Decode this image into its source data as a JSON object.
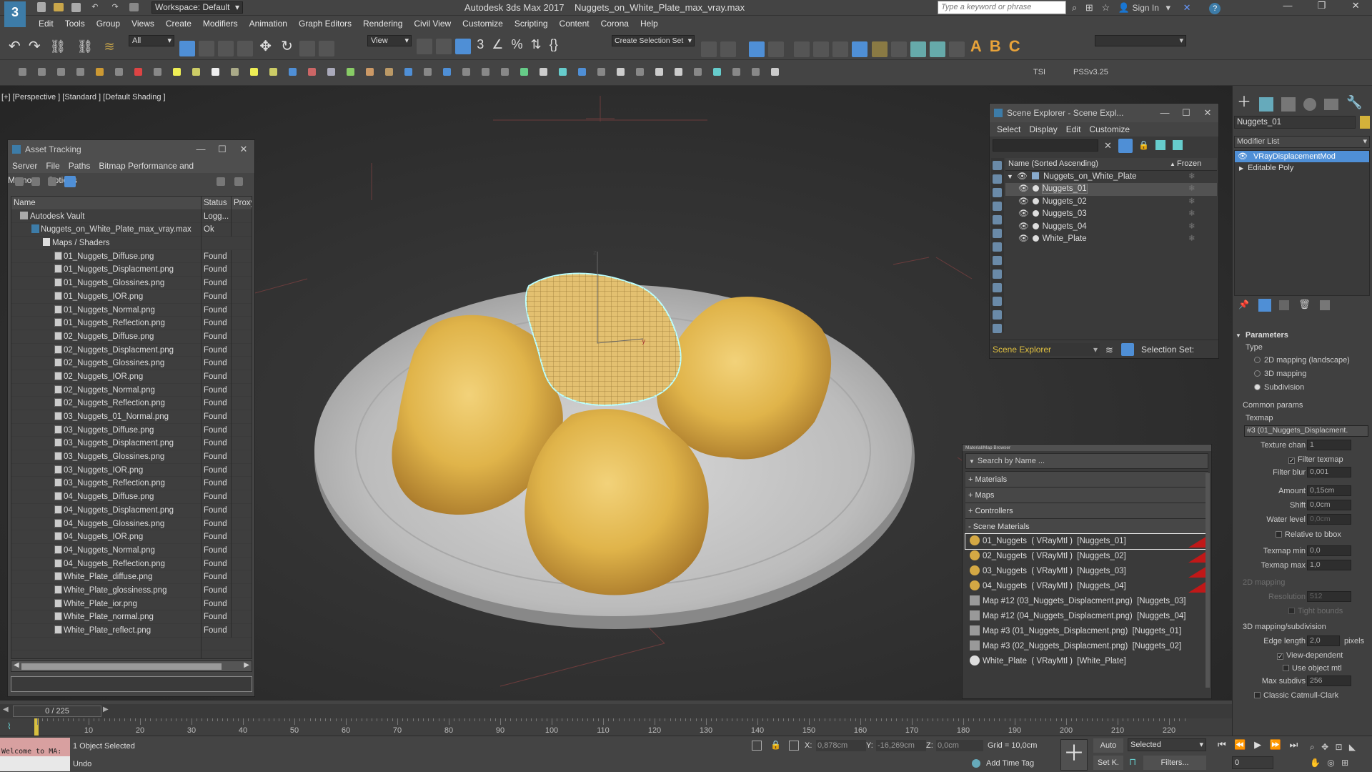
{
  "app": {
    "title": "Autodesk 3ds Max 2017",
    "file": "Nuggets_on_White_Plate_max_vray.max",
    "workspace": "Workspace: Default",
    "search_placeholder": "Type a keyword or phrase",
    "sign_in": "Sign In"
  },
  "menu": [
    "Edit",
    "Tools",
    "Group",
    "Views",
    "Create",
    "Modifiers",
    "Animation",
    "Graph Editors",
    "Rendering",
    "Civil View",
    "Customize",
    "Scripting",
    "Content",
    "Corona",
    "Help"
  ],
  "toolbar": {
    "filter": "All",
    "view": "View",
    "selection_set": "Create Selection Set",
    "tsi": "TSI",
    "pss": "PSSv3.25"
  },
  "viewport": {
    "label": "[+] [Perspective ] [Standard ] [Default Shading ]"
  },
  "asset_tracking": {
    "title": "Asset Tracking",
    "menu": [
      "Server",
      "File",
      "Paths",
      "Bitmap Performance and Memory",
      "Options"
    ],
    "columns": [
      "Name",
      "Status",
      "Proxy"
    ],
    "vault": {
      "name": "Autodesk Vault",
      "status": "Logg..."
    },
    "file": {
      "name": "Nuggets_on_White_Plate_max_vray.max",
      "status": "Ok"
    },
    "group": "Maps / Shaders",
    "maps": [
      "01_Nuggets_Diffuse.png",
      "01_Nuggets_Displacment.png",
      "01_Nuggets_Glossines.png",
      "01_Nuggets_IOR.png",
      "01_Nuggets_Normal.png",
      "01_Nuggets_Reflection.png",
      "02_Nuggets_Diffuse.png",
      "02_Nuggets_Displacment.png",
      "02_Nuggets_Glossines.png",
      "02_Nuggets_IOR.png",
      "02_Nuggets_Normal.png",
      "02_Nuggets_Reflection.png",
      "03_Nuggets_01_Normal.png",
      "03_Nuggets_Diffuse.png",
      "03_Nuggets_Displacment.png",
      "03_Nuggets_Glossines.png",
      "03_Nuggets_IOR.png",
      "03_Nuggets_Reflection.png",
      "04_Nuggets_Diffuse.png",
      "04_Nuggets_Displacment.png",
      "04_Nuggets_Glossines.png",
      "04_Nuggets_IOR.png",
      "04_Nuggets_Normal.png",
      "04_Nuggets_Reflection.png",
      "White_Plate_diffuse.png",
      "White_Plate_glossiness.png",
      "White_Plate_ior.png",
      "White_Plate_normal.png",
      "White_Plate_reflect.png"
    ],
    "found": "Found"
  },
  "scene_explorer": {
    "title": "Scene Explorer - Scene Expl...",
    "menu": [
      "Select",
      "Display",
      "Edit",
      "Customize"
    ],
    "col_name": "Name (Sorted Ascending)",
    "col_frozen": "Frozen",
    "root": "Nuggets_on_White_Plate",
    "items": [
      "Nuggets_01",
      "Nuggets_02",
      "Nuggets_03",
      "Nuggets_04",
      "White_Plate"
    ],
    "footer_label": "Scene Explorer",
    "selection_set": "Selection Set:"
  },
  "material_browser": {
    "title": "Material/Map Browser",
    "search": "Search by Name ...",
    "groups": [
      "+ Materials",
      "+ Maps",
      "+ Controllers",
      "- Scene Materials"
    ],
    "items": [
      "01_Nuggets  ( VRayMtl )  [Nuggets_01]",
      "02_Nuggets  ( VRayMtl )  [Nuggets_02]",
      "03_Nuggets  ( VRayMtl )  [Nuggets_03]",
      "04_Nuggets  ( VRayMtl )  [Nuggets_04]",
      "Map #12 (03_Nuggets_Displacment.png)  [Nuggets_03]",
      "Map #12 (04_Nuggets_Displacment.png)  [Nuggets_04]",
      "Map #3 (01_Nuggets_Displacment.png)  [Nuggets_01]",
      "Map #3 (02_Nuggets_Displacment.png)  [Nuggets_02]",
      "White_Plate  ( VRayMtl )  [White_Plate]"
    ]
  },
  "command_panel": {
    "object_name": "Nuggets_01",
    "modifier_list": "Modifier List",
    "stack": [
      "VRayDisplacementMod",
      "Editable Poly"
    ],
    "rollout": "Parameters",
    "type_label": "Type",
    "types": [
      "2D mapping (landscape)",
      "3D mapping",
      "Subdivision"
    ],
    "common": "Common params",
    "texmap": "Texmap",
    "texmap_value": "#3 (01_Nuggets_Displacment.",
    "texture_chan": "Texture chan",
    "texture_chan_val": "1",
    "filter_texmap": "Filter texmap",
    "filter_blur": "Filter blur",
    "filter_blur_val": "0,001",
    "amount": "Amount",
    "amount_val": "0,15cm",
    "shift": "Shift",
    "shift_val": "0,0cm",
    "water": "Water level",
    "water_val": "0,0cm",
    "rel_bbox": "Relative to bbox",
    "tmin": "Texmap min",
    "tmin_val": "0,0",
    "tmax": "Texmap max",
    "tmax_val": "1,0",
    "map2d": "2D mapping",
    "resolution": "Resolution",
    "resolution_val": "512",
    "tight": "Tight bounds",
    "map3d": "3D mapping/subdivision",
    "edge": "Edge length",
    "edge_val": "2,0",
    "pixels": "pixels",
    "view_dep": "View-dependent",
    "use_obj": "Use object mtl",
    "max_subdivs": "Max subdivs",
    "max_subdivs_val": "256",
    "catmull": "Classic Catmull-Clark"
  },
  "timeline": {
    "frame": "0 / 225",
    "ticks": [
      "10",
      "20",
      "30",
      "40",
      "50",
      "60",
      "70",
      "80",
      "90",
      "100",
      "110",
      "120",
      "130",
      "140",
      "150",
      "160",
      "170",
      "180",
      "190",
      "200",
      "210",
      "220"
    ]
  },
  "status": {
    "welcome": "Welcome to MA:",
    "selected": "1 Object Selected",
    "undo": "Undo",
    "x_label": "X:",
    "x": "0,878cm",
    "y_label": "Y:",
    "y": "-16,269cm",
    "z_label": "Z:",
    "z": "0,0cm",
    "grid": "Grid = 10,0cm",
    "add_time_tag": "Add Time Tag",
    "auto": "Auto",
    "set_k": "Set K.",
    "selected_dd": "Selected",
    "filters": "Filters...",
    "frame_field": "0"
  }
}
